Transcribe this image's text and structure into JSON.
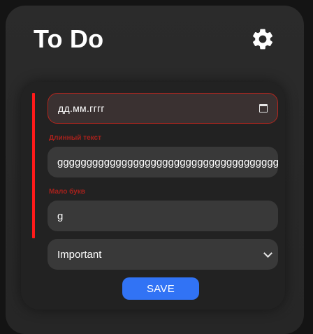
{
  "header": {
    "title": "To Do",
    "settings_icon": "gear-icon"
  },
  "form": {
    "date": {
      "value": "дд.мм.гггг",
      "icon": "calendar-icon",
      "state": "error"
    },
    "text": {
      "error": "Длинный текст",
      "value": "gggggggggggggggggggggggggggggggggggggggggggggg"
    },
    "short": {
      "error": "Мало букв",
      "value": "g"
    },
    "priority": {
      "selected": "Important"
    },
    "save_label": "SAVE"
  },
  "colors": {
    "error_bar": "#ff1a1a",
    "error_text": "#a5211c",
    "accent": "#3173f5",
    "background": "#141414",
    "card": "#2b2b2b",
    "panel": "#222222",
    "field": "#393939"
  }
}
